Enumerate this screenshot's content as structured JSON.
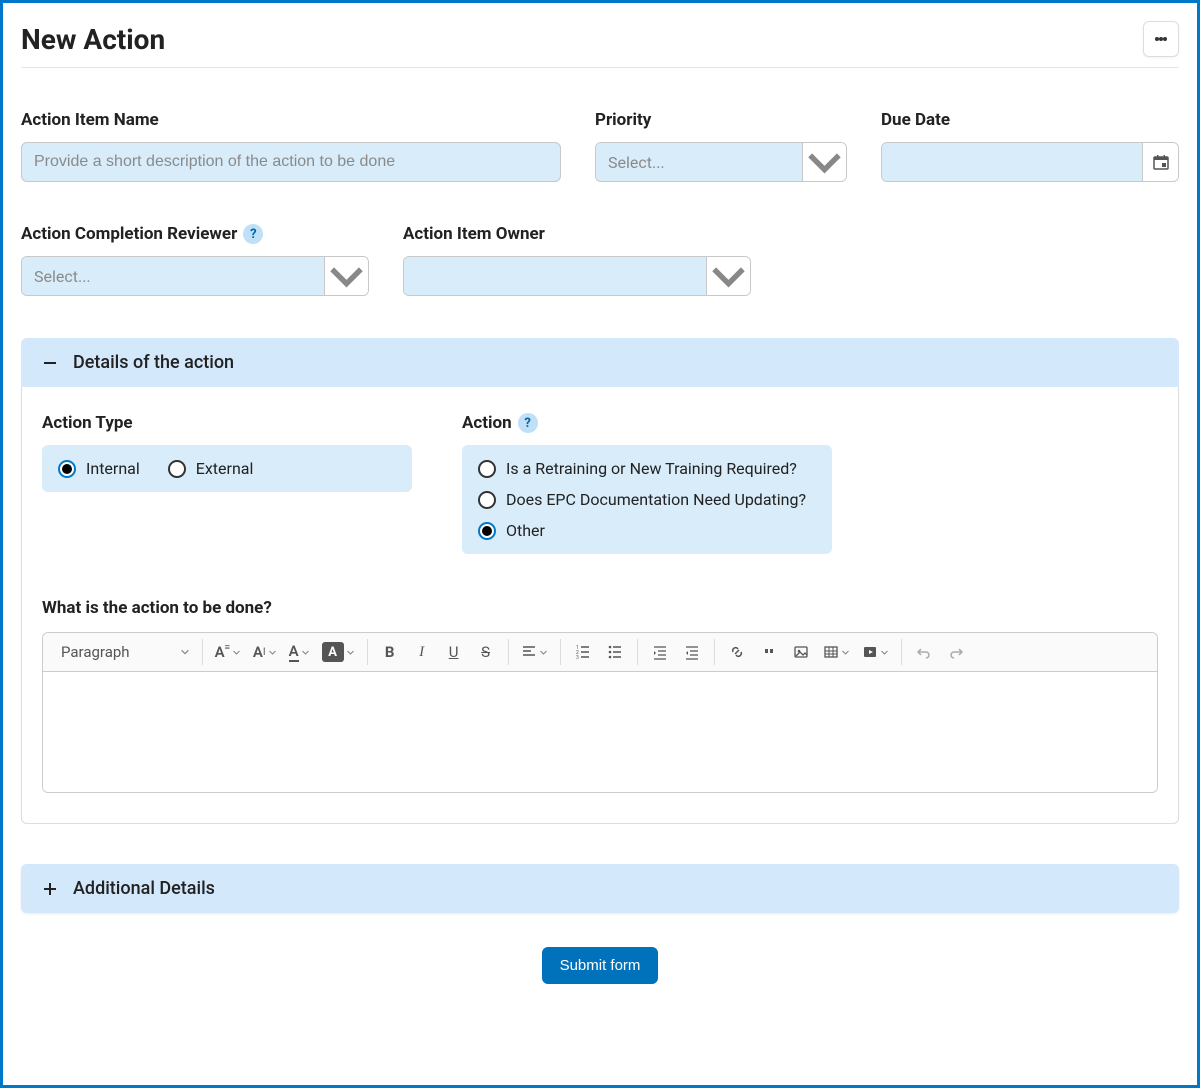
{
  "page_title": "New Action",
  "fields": {
    "action_item_name": {
      "label": "Action Item Name",
      "placeholder": "Provide a short description of the action to be done"
    },
    "priority": {
      "label": "Priority",
      "placeholder": "Select..."
    },
    "due_date": {
      "label": "Due Date"
    },
    "reviewer": {
      "label": "Action Completion Reviewer",
      "placeholder": "Select..."
    },
    "owner": {
      "label": "Action Item Owner"
    }
  },
  "sections": {
    "details": {
      "title": "Details of the action",
      "action_type": {
        "label": "Action Type",
        "options": [
          "Internal",
          "External"
        ],
        "selected": "Internal"
      },
      "action": {
        "label": "Action",
        "options": [
          "Is a Retraining or New Training Required?",
          "Does EPC Documentation Need Updating?",
          "Other"
        ],
        "selected": "Other"
      },
      "editor_label": "What is the action to be done?",
      "toolbar": {
        "paragraph": "Paragraph"
      }
    },
    "additional": {
      "title": "Additional Details"
    }
  },
  "submit_label": "Submit form",
  "help_char": "?"
}
